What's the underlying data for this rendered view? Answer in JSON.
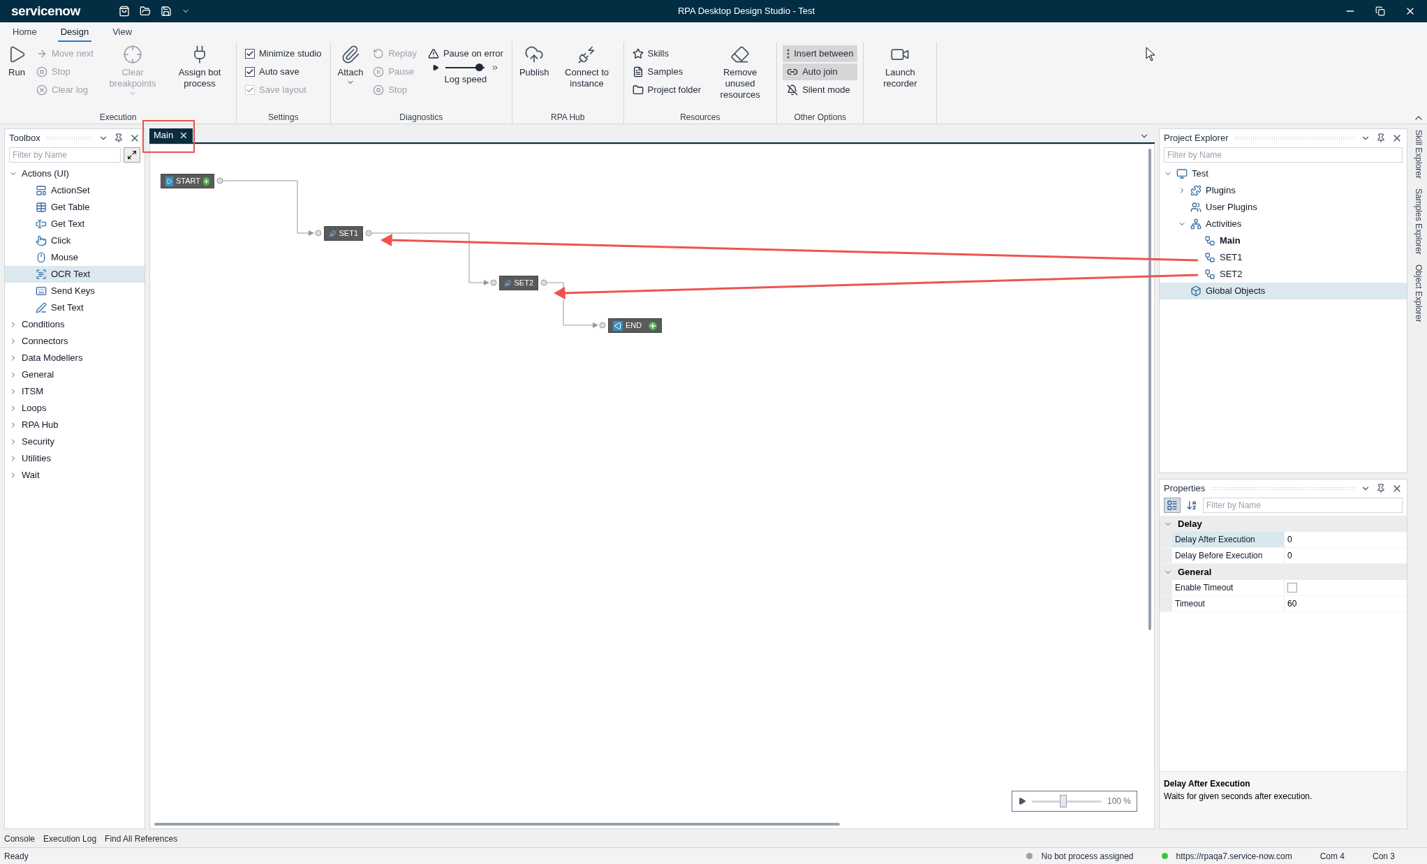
{
  "window": {
    "brand": "servicenow",
    "title": "RPA Desktop Design Studio - Test"
  },
  "menu_tabs": [
    {
      "label": "Home",
      "selected": false
    },
    {
      "label": "Design",
      "selected": true
    },
    {
      "label": "View",
      "selected": false
    }
  ],
  "ribbon": [
    {
      "label": "Execution",
      "columns": [
        {
          "kind": "large",
          "label": "Run",
          "disabled": false
        },
        {
          "kind": "stack",
          "items": [
            {
              "kind": "button",
              "label": "Move next",
              "disabled": true
            },
            {
              "kind": "button",
              "label": "Stop",
              "disabled": true
            },
            {
              "kind": "button",
              "label": "Clear log",
              "disabled": true
            }
          ]
        },
        {
          "kind": "large",
          "label": "Clear breakpoints",
          "disabled": true,
          "dropdown": true
        },
        {
          "kind": "large",
          "label": "Assign bot process",
          "disabled": false
        }
      ]
    },
    {
      "label": "Settings",
      "columns": [
        {
          "kind": "stack",
          "items": [
            {
              "kind": "check",
              "label": "Minimize studio",
              "checked": true,
              "disabled": false
            },
            {
              "kind": "check",
              "label": "Auto save",
              "checked": true,
              "disabled": false
            },
            {
              "kind": "check",
              "label": "Save layout",
              "checked": true,
              "disabled": true
            }
          ]
        }
      ]
    },
    {
      "label": "Diagnostics",
      "columns": [
        {
          "kind": "large",
          "label": "Attach",
          "disabled": false,
          "dropdown": true
        },
        {
          "kind": "stack",
          "items": [
            {
              "kind": "button",
              "label": "Replay",
              "disabled": true
            },
            {
              "kind": "button",
              "label": "Pause",
              "disabled": true
            },
            {
              "kind": "button",
              "label": "Stop",
              "disabled": true
            }
          ]
        },
        {
          "kind": "stack",
          "items": [
            {
              "kind": "button",
              "label": "Pause on error",
              "disabled": false
            },
            {
              "kind": "slider",
              "label": "Log speed",
              "level": 0.85
            }
          ]
        }
      ]
    },
    {
      "label": "RPA Hub",
      "columns": [
        {
          "kind": "large",
          "label": "Publish",
          "disabled": false
        },
        {
          "kind": "large",
          "label": "Connect to instance",
          "disabled": false
        }
      ]
    },
    {
      "label": "Resources",
      "columns": [
        {
          "kind": "stack",
          "items": [
            {
              "kind": "button",
              "label": "Skills",
              "disabled": false
            },
            {
              "kind": "button",
              "label": "Samples",
              "disabled": false
            },
            {
              "kind": "button",
              "label": "Project folder",
              "disabled": false
            }
          ]
        },
        {
          "kind": "large",
          "label": "Remove unused resources",
          "disabled": false
        }
      ]
    },
    {
      "label": "Other Options",
      "columns": [
        {
          "kind": "stack",
          "items": [
            {
              "kind": "toggle",
              "label": "Insert between",
              "on": true
            },
            {
              "kind": "toggle",
              "label": "Auto join",
              "on": true
            },
            {
              "kind": "toggle",
              "label": "Silent mode",
              "on": false
            }
          ]
        }
      ]
    },
    {
      "columns": [
        {
          "kind": "large",
          "label": "Launch recorder",
          "disabled": false
        }
      ]
    }
  ],
  "toolbox": {
    "title": "Toolbox",
    "filter": {
      "placeholder": "Filter by Name"
    },
    "tree": [
      {
        "label": "Actions (UI)",
        "expanded": true,
        "children": [
          {
            "label": "ActionSet",
            "selected": false
          },
          {
            "label": "Get Table",
            "selected": false
          },
          {
            "label": "Get Text",
            "selected": false
          },
          {
            "label": "Click",
            "selected": false
          },
          {
            "label": "Mouse",
            "selected": false
          },
          {
            "label": "OCR Text",
            "selected": true
          },
          {
            "label": "Send Keys",
            "selected": false
          },
          {
            "label": "Set Text",
            "selected": false
          }
        ]
      },
      {
        "label": "Conditions",
        "expanded": false
      },
      {
        "label": "Connectors",
        "expanded": false
      },
      {
        "label": "Data Modellers",
        "expanded": false
      },
      {
        "label": "General",
        "expanded": false
      },
      {
        "label": "ITSM",
        "expanded": false
      },
      {
        "label": "Loops",
        "expanded": false
      },
      {
        "label": "RPA Hub",
        "expanded": false
      },
      {
        "label": "Security",
        "expanded": false
      },
      {
        "label": "Utilities",
        "expanded": false
      },
      {
        "label": "Wait",
        "expanded": false
      }
    ]
  },
  "document_tab": {
    "label": "Main",
    "selected": true
  },
  "diagram": {
    "nodes": [
      {
        "label": "START",
        "kind": "start"
      },
      {
        "label": "SET1",
        "kind": "set"
      },
      {
        "label": "SET2",
        "kind": "set"
      },
      {
        "label": "END",
        "kind": "end"
      }
    ],
    "zoom": {
      "level": 0.45,
      "reading": "100 %"
    }
  },
  "project_explorer": {
    "title": "Project Explorer",
    "filter": {
      "placeholder": "Filter by Name"
    },
    "tree": [
      {
        "label": "Test",
        "expanded": true,
        "selected": false,
        "children": [
          {
            "label": "Plugins",
            "expanded": false,
            "selected": false
          },
          {
            "label": "User Plugins",
            "selected": false
          },
          {
            "label": "Activities",
            "expanded": true,
            "selected": false,
            "children": [
              {
                "label": "Main",
                "bold": true,
                "selected": false
              },
              {
                "label": "SET1",
                "bold": false,
                "selected": false
              },
              {
                "label": "SET2",
                "bold": false,
                "selected": false
              }
            ]
          },
          {
            "label": "Global Objects",
            "selected": true
          }
        ]
      }
    ]
  },
  "properties": {
    "title": "Properties",
    "view_buttons": [
      {
        "selected": true
      },
      {
        "selected": false
      }
    ],
    "filter": {
      "placeholder": "Filter by Name"
    },
    "groups": [
      {
        "label": "Delay",
        "expanded": true,
        "rows": [
          {
            "name": "Delay After Execution",
            "kind": "text",
            "value": "0",
            "selected": true
          },
          {
            "name": "Delay Before Execution",
            "kind": "text",
            "value": "0",
            "selected": false
          }
        ]
      },
      {
        "label": "General",
        "expanded": true,
        "rows": [
          {
            "name": "Enable Timeout",
            "kind": "checkbox",
            "checked": false,
            "selected": false
          },
          {
            "name": "Timeout",
            "kind": "text",
            "value": "60",
            "selected": false
          }
        ]
      }
    ],
    "description": {
      "title": "Delay After Execution",
      "text": "Waits for given seconds after execution."
    }
  },
  "side_tabs": [
    "Skill Explorer",
    "Samples Explorer",
    "Object Explorer"
  ],
  "bottom_tabs": [
    "Console",
    "Execution Log",
    "Find All References"
  ],
  "status_bar": {
    "text": "Ready",
    "items": [
      {
        "label": "No bot process assigned",
        "color": "#a0a0a0"
      },
      {
        "label": "https://rpaqa7.service-now.com",
        "color": "#3cc43c"
      }
    ],
    "counters": [
      "Com 4",
      "Con 3"
    ]
  }
}
